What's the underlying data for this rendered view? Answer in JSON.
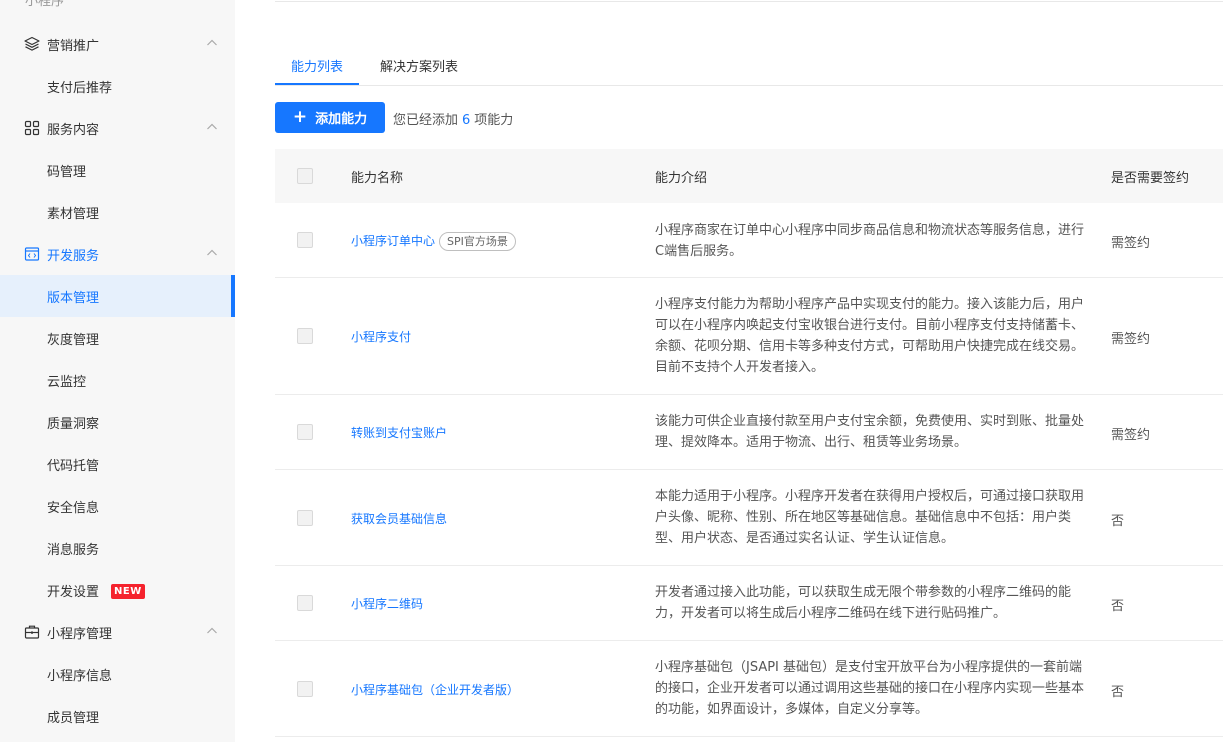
{
  "sidebar": {
    "top_label": "小程序",
    "groups": [
      {
        "label": "营销推广",
        "icon": "layers-icon",
        "items": [
          "支付后推荐"
        ]
      },
      {
        "label": "服务内容",
        "icon": "apps-icon",
        "items": [
          "码管理",
          "素材管理"
        ]
      },
      {
        "label": "开发服务",
        "icon": "code-window-icon",
        "items": [
          "版本管理",
          "灰度管理",
          "云监控",
          "质量洞察",
          "代码托管",
          "安全信息",
          "消息服务",
          "开发设置"
        ]
      },
      {
        "label": "小程序管理",
        "icon": "briefcase-icon",
        "items": [
          "小程序信息",
          "成员管理"
        ]
      }
    ],
    "selected_item": "版本管理",
    "new_badge": "NEW"
  },
  "tabs": [
    "能力列表",
    "解决方案列表"
  ],
  "toolbar": {
    "add_button": "添加能力",
    "added_prefix": "您已经添加",
    "added_count": "6",
    "added_suffix": "项能力"
  },
  "table": {
    "headers": [
      "能力名称",
      "能力介绍",
      "是否需要签约"
    ],
    "rows": [
      {
        "name": "小程序订单中心",
        "tag": "SPI官方场景",
        "desc": "小程序商家在订单中心小程序中同步商品信息和物流状态等服务信息，进行C端售后服务。",
        "sign": "需签约"
      },
      {
        "name": "小程序支付",
        "tag": "",
        "desc": "小程序支付能力为帮助小程序产品中实现支付的能力。接入该能力后，用户可以在小程序内唤起支付宝收银台进行支付。目前小程序支付支持储蓄卡、余额、花呗分期、信用卡等多种支付方式，可帮助用户快捷完成在线交易。目前不支持个人开发者接入。",
        "sign": "需签约"
      },
      {
        "name": "转账到支付宝账户",
        "tag": "",
        "desc": "该能力可供企业直接付款至用户支付宝余额，免费使用、实时到账、批量处理、提效降本。适用于物流、出行、租赁等业务场景。",
        "sign": "需签约"
      },
      {
        "name": "获取会员基础信息",
        "tag": "",
        "desc": "本能力适用于小程序。小程序开发者在获得用户授权后，可通过接口获取用户头像、昵称、性别、所在地区等基础信息。基础信息中不包括：用户类型、用户状态、是否通过实名认证、学生认证信息。",
        "sign": "否"
      },
      {
        "name": "小程序二维码",
        "tag": "",
        "desc": "开发者通过接入此功能，可以获取生成无限个带参数的小程序二维码的能力，开发者可以将生成后小程序二维码在线下进行贴码推广。",
        "sign": "否"
      },
      {
        "name": "小程序基础包（企业开发者版）",
        "tag": "",
        "desc": "小程序基础包（JSAPI 基础包）是支付宝开放平台为小程序提供的一套前端的接口，企业开发者可以通过调用这些基础的接口在小程序内实现一些基本的功能，如界面设计，多媒体，自定义分享等。",
        "sign": "否"
      }
    ]
  },
  "colors": {
    "accent": "#1677ff",
    "badge": "#f5222d",
    "sidebar_bg": "#f7f7f7",
    "selected_bg": "#e6f0fc"
  }
}
